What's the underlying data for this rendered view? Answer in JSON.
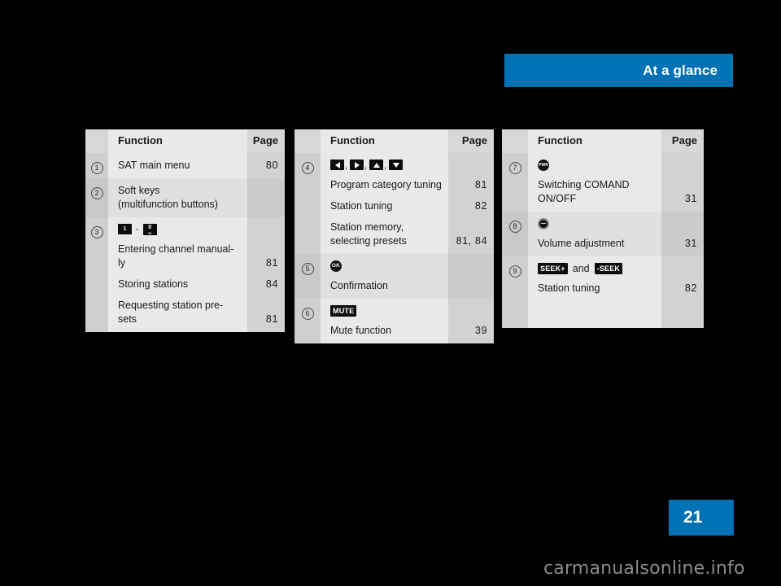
{
  "header": {
    "title": "At a glance"
  },
  "page_badge": {
    "number": "21"
  },
  "watermark": {
    "text": "carmanualsonline.info"
  },
  "colors": {
    "accent_blue": "#0071b3",
    "background": "#000000",
    "table_base": "#e0e0e0",
    "page_col": "#d0d0d0",
    "key_black": "#0d0d0d"
  },
  "columns": {
    "function": "Function",
    "page": "Page"
  },
  "tables": [
    {
      "id": "table-1",
      "rows": [
        {
          "marker": "1",
          "icon": null,
          "lines": [
            {
              "text": "SAT main menu",
              "page": "80"
            }
          ]
        },
        {
          "marker": "2",
          "icon": null,
          "lines": [
            {
              "text": "Soft keys\n(multifunction buttons)",
              "page": ""
            }
          ]
        },
        {
          "marker": "3",
          "icon": "key-range-1-to-0",
          "lines": [
            {
              "text": "Entering channel manual-\nly",
              "page": "81"
            },
            {
              "text": "Storing stations",
              "page": "84"
            },
            {
              "text": "Requesting station pre-\nsets",
              "page": "81"
            }
          ]
        }
      ]
    },
    {
      "id": "table-2",
      "rows": [
        {
          "marker": "4",
          "icon": "arrow-keys-left-right-up-down",
          "lines": [
            {
              "text": "Program category tuning",
              "page": "81"
            },
            {
              "text": "Station tuning",
              "page": "82"
            },
            {
              "text": "Station memory,\nselecting presets",
              "page": "81, 84"
            }
          ]
        },
        {
          "marker": "5",
          "icon": "ok-button",
          "lines": [
            {
              "text": "Confirmation",
              "page": ""
            }
          ]
        },
        {
          "marker": "6",
          "icon": "mute-button",
          "lines": [
            {
              "text": "Mute function",
              "page": "39"
            }
          ]
        }
      ]
    },
    {
      "id": "table-3",
      "rows": [
        {
          "marker": "7",
          "icon": "power-button",
          "lines": [
            {
              "text": "Switching COMAND\nON/OFF",
              "page": "31"
            }
          ]
        },
        {
          "marker": "8",
          "icon": "volume-knob",
          "lines": [
            {
              "text": "Volume adjustment",
              "page": "31"
            }
          ]
        },
        {
          "marker": "9",
          "icon": "seek-buttons",
          "lines": [
            {
              "text": "Station tuning",
              "page": "82"
            }
          ]
        }
      ]
    }
  ],
  "icon_labels": {
    "key_one": "1",
    "key_zero_top": "0",
    "key_zero_bottom": "␣",
    "range_dash": "-",
    "comma": ",",
    "ok": "OK",
    "pwr": "PWR",
    "mute": "MUTE",
    "seek_plus": "SEEK+",
    "seek_minus": "-SEEK",
    "and": "and"
  }
}
